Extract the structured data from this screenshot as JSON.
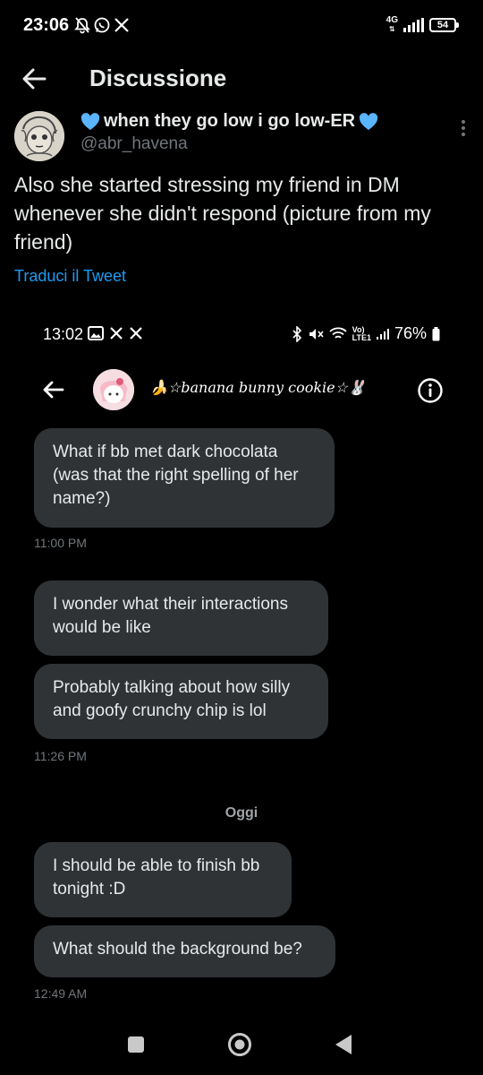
{
  "status_bar": {
    "time": "23:06",
    "network_type": "4G",
    "battery": "54",
    "icons": [
      "mute-bell-icon",
      "whatsapp-icon",
      "x-icon"
    ]
  },
  "header": {
    "title": "Discussione",
    "back_icon": "arrow-left-icon"
  },
  "tweet": {
    "display_name": "when they go low i go low-ER",
    "name_emoji": "blue-heart",
    "handle": "@abr_havena",
    "text": "Also she started stressing my friend in DM whenever she didn't respond (picture from my friend)",
    "translate_label": "Traduci il Tweet",
    "accent_color": "#1d9bf0"
  },
  "embedded_screenshot": {
    "status_bar": {
      "time": "13:02",
      "battery": "76%",
      "icons": [
        "image-icon",
        "x-icon",
        "x-icon",
        "bluetooth-icon",
        "mute-icon",
        "wifi-icon",
        "volte-icon",
        "signal-icon",
        "battery-icon"
      ]
    },
    "chat_header": {
      "name": "🍌☆banana bunny cookie☆🐰"
    },
    "messages": [
      {
        "text": "What if bb met dark chocolata (was that the right spelling of her name?)"
      },
      {
        "timestamp": "11:00 PM"
      },
      {
        "text": "I wonder what their interactions would be like"
      },
      {
        "text": "Probably talking about how silly and goofy crunchy chip is lol"
      },
      {
        "timestamp": "11:26 PM"
      },
      {
        "day_label": "Oggi"
      },
      {
        "text": "I should be able to finish bb tonight :D"
      },
      {
        "text": "What should the background be?"
      },
      {
        "timestamp": "12:49 AM"
      }
    ],
    "bubble_color": "#2f3336"
  },
  "nav_bar": {
    "icons": [
      "recent-apps-icon",
      "home-icon",
      "back-triangle-icon"
    ]
  }
}
